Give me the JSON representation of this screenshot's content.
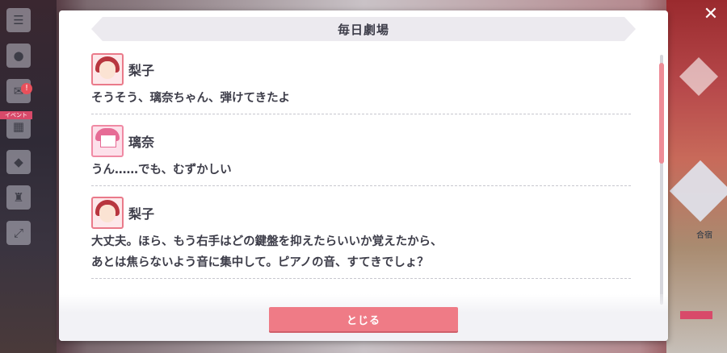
{
  "background": {
    "side_menu": [
      "menu-icon",
      "chat-icon",
      "gift-icon",
      "present-icon",
      "gem-icon",
      "trophy-icon",
      "expand-icon"
    ],
    "event_tag": "イベント",
    "right_label": "合宿",
    "colors": {
      "accent": "#ef7b86",
      "badge": "#e8505b"
    }
  },
  "dialog": {
    "title": "毎日劇場",
    "entries": [
      {
        "speaker": "梨子",
        "avatar": "riko-avatar",
        "lines": [
          "そうそう、璃奈ちゃん、弾けてきたよ"
        ]
      },
      {
        "speaker": "璃奈",
        "avatar": "rina-avatar",
        "lines": [
          "うん……でも、むずかしい"
        ]
      },
      {
        "speaker": "梨子",
        "avatar": "riko-avatar",
        "lines": [
          "大丈夫。ほら、もう右手はどの鍵盤を抑えたらいいか覚えたから、",
          "あとは焦らないよう音に集中して。ピアノの音、すてきでしょ？"
        ]
      }
    ],
    "close_label": "とじる"
  }
}
